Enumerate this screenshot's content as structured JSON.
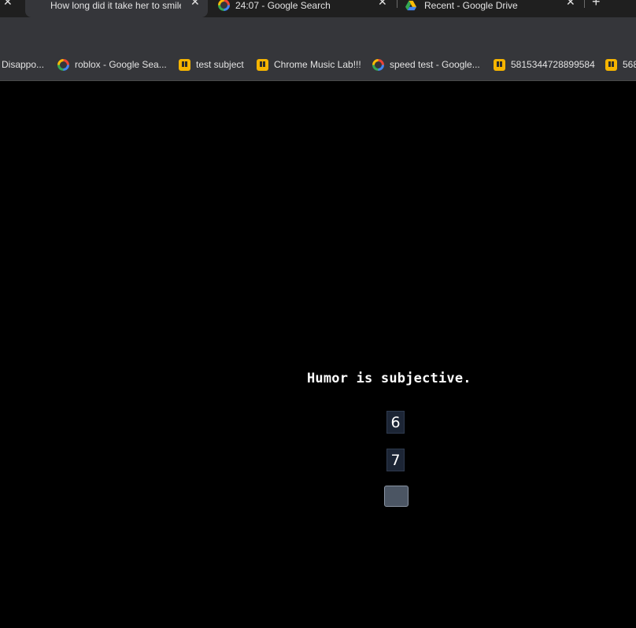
{
  "tabs": [
    {
      "title": "How long did it take her to smile",
      "active": true,
      "icon": "none"
    },
    {
      "title": "24:07 - Google Search",
      "active": false,
      "icon": "google-icon"
    },
    {
      "title": "Recent - Google Drive",
      "active": false,
      "icon": "google-drive-icon"
    }
  ],
  "tab_close_glyph": "✕",
  "new_tab_glyph": "+",
  "bookmarks": [
    {
      "label": "Disappo...",
      "icon": "none"
    },
    {
      "label": "roblox - Google Sea...",
      "icon": "google-icon"
    },
    {
      "label": "test subject",
      "icon": "piano-icon"
    },
    {
      "label": "Chrome Music Lab!!!",
      "icon": "piano-icon"
    },
    {
      "label": "speed test - Google...",
      "icon": "google-icon"
    },
    {
      "label": "5815344728899584",
      "icon": "piano-icon"
    },
    {
      "label": "568",
      "icon": "piano-icon"
    }
  ],
  "page": {
    "caption": "Humor is subjective.",
    "inputs": [
      {
        "value": "6"
      },
      {
        "value": "7"
      }
    ]
  },
  "colors": {
    "page_background": "#000000",
    "chrome_background": "#35363a",
    "input_background": "#1c2535",
    "button_background": "#4b5563"
  }
}
